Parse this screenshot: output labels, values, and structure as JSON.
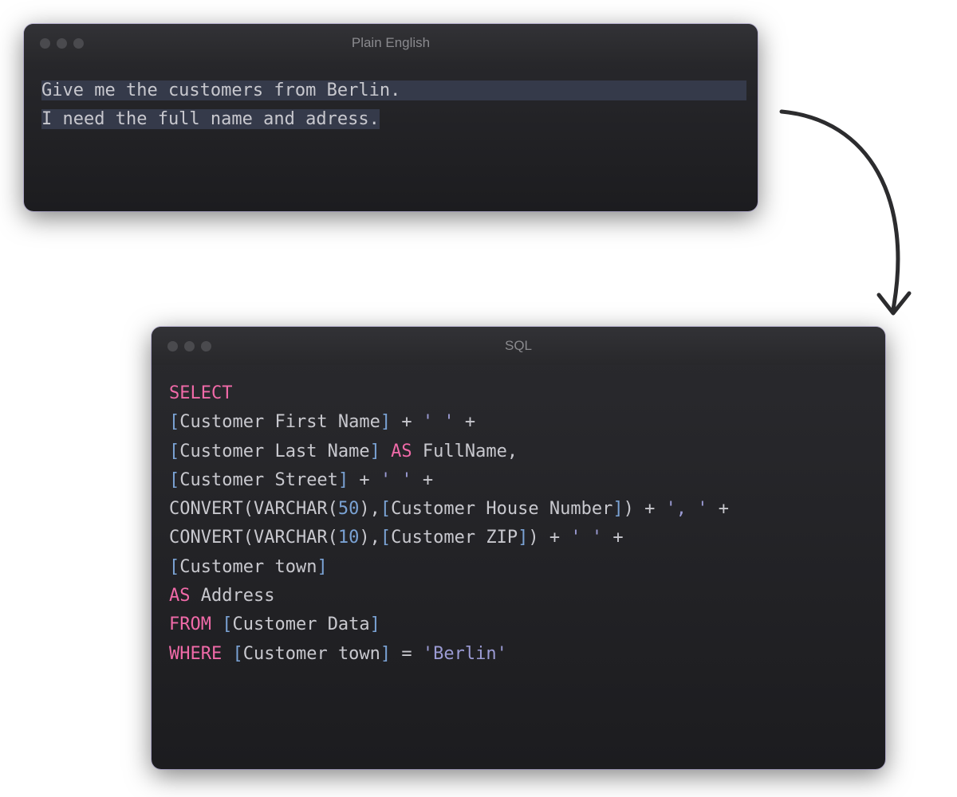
{
  "english_window": {
    "title": "Plain English",
    "line1": "Give me the customers from Berlin.",
    "line2": "I need the full name and adress."
  },
  "sql_window": {
    "title": "SQL",
    "tokens": [
      [
        {
          "t": "SELECT",
          "c": "kw-pink"
        }
      ],
      [
        {
          "t": "[",
          "c": "kw-blue"
        },
        {
          "t": "Customer First Name",
          "c": "kw-default"
        },
        {
          "t": "]",
          "c": "kw-blue"
        },
        {
          "t": " + ",
          "c": "kw-default"
        },
        {
          "t": "' '",
          "c": "kw-string"
        },
        {
          "t": " +",
          "c": "kw-default"
        }
      ],
      [
        {
          "t": "[",
          "c": "kw-blue"
        },
        {
          "t": "Customer Last Name",
          "c": "kw-default"
        },
        {
          "t": "]",
          "c": "kw-blue"
        },
        {
          "t": " ",
          "c": "kw-default"
        },
        {
          "t": "AS",
          "c": "kw-pink"
        },
        {
          "t": " FullName,",
          "c": "kw-default"
        }
      ],
      [
        {
          "t": "[",
          "c": "kw-blue"
        },
        {
          "t": "Customer Street",
          "c": "kw-default"
        },
        {
          "t": "]",
          "c": "kw-blue"
        },
        {
          "t": " + ",
          "c": "kw-default"
        },
        {
          "t": "' '",
          "c": "kw-string"
        },
        {
          "t": " +",
          "c": "kw-default"
        }
      ],
      [
        {
          "t": "CONVERT(VARCHAR(",
          "c": "kw-default"
        },
        {
          "t": "50",
          "c": "kw-blue"
        },
        {
          "t": "),",
          "c": "kw-default"
        },
        {
          "t": "[",
          "c": "kw-blue"
        },
        {
          "t": "Customer House Number",
          "c": "kw-default"
        },
        {
          "t": "]",
          "c": "kw-blue"
        },
        {
          "t": ") + ",
          "c": "kw-default"
        },
        {
          "t": "', '",
          "c": "kw-string"
        },
        {
          "t": " +",
          "c": "kw-default"
        }
      ],
      [
        {
          "t": "CONVERT(VARCHAR(",
          "c": "kw-default"
        },
        {
          "t": "10",
          "c": "kw-blue"
        },
        {
          "t": "),",
          "c": "kw-default"
        },
        {
          "t": "[",
          "c": "kw-blue"
        },
        {
          "t": "Customer ZIP",
          "c": "kw-default"
        },
        {
          "t": "]",
          "c": "kw-blue"
        },
        {
          "t": ") + ",
          "c": "kw-default"
        },
        {
          "t": "' '",
          "c": "kw-string"
        },
        {
          "t": " +",
          "c": "kw-default"
        }
      ],
      [
        {
          "t": "[",
          "c": "kw-blue"
        },
        {
          "t": "Customer town",
          "c": "kw-default"
        },
        {
          "t": "]",
          "c": "kw-blue"
        }
      ],
      [
        {
          "t": "AS",
          "c": "kw-pink"
        },
        {
          "t": " Address",
          "c": "kw-default"
        }
      ],
      [
        {
          "t": "FROM",
          "c": "kw-pink"
        },
        {
          "t": " ",
          "c": "kw-default"
        },
        {
          "t": "[",
          "c": "kw-blue"
        },
        {
          "t": "Customer Data",
          "c": "kw-default"
        },
        {
          "t": "]",
          "c": "kw-blue"
        }
      ],
      [
        {
          "t": "WHERE",
          "c": "kw-pink"
        },
        {
          "t": " ",
          "c": "kw-default"
        },
        {
          "t": "[",
          "c": "kw-blue"
        },
        {
          "t": "Customer town",
          "c": "kw-default"
        },
        {
          "t": "]",
          "c": "kw-blue"
        },
        {
          "t": " = ",
          "c": "kw-default"
        },
        {
          "t": "'Berlin'",
          "c": "kw-string"
        }
      ]
    ]
  }
}
